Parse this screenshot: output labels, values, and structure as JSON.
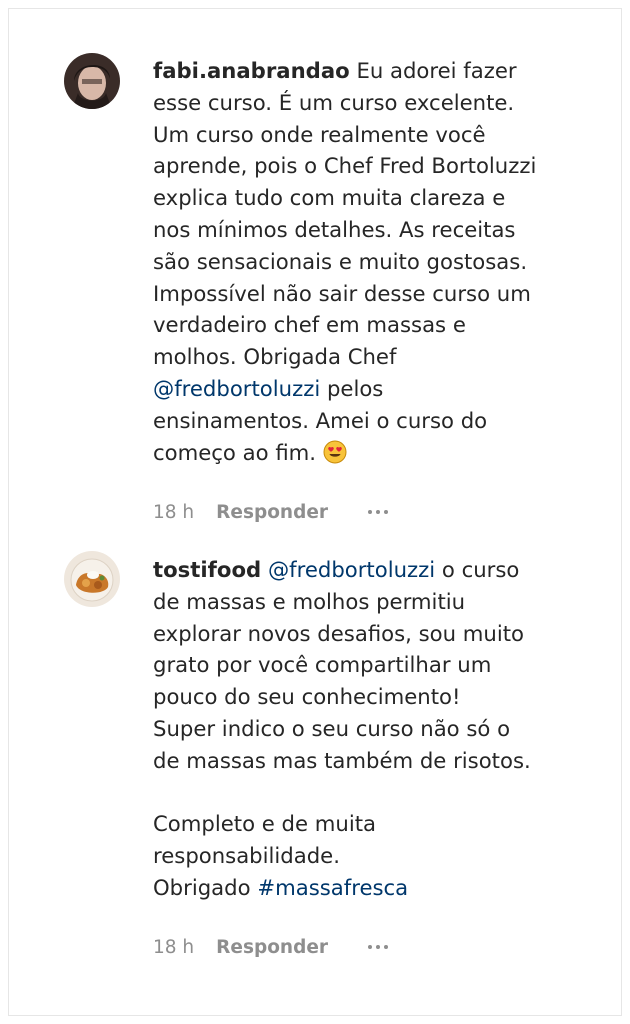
{
  "comments": [
    {
      "username": "fabi.anabrandao",
      "text_before_mention": "Eu adorei fazer\nesse curso. É um curso excelente.\nUm curso onde realmente você\naprende, pois o Chef Fred Bortoluzzi\nexplica tudo com muita clareza e\nnos mínimos detalhes. As receitas\nsão sensacionais e muito gostosas.\nImpossível não sair desse curso um\nverdadeiro chef em massas e\nmolhos. Obrigada Chef\n",
      "mention": "@fredbortoluzzi",
      "text_after_mention": " pelos\nensinamentos. Amei o curso do\ncomeço ao fim. ",
      "emoji_icon": "heart-eyes-emoji-icon",
      "time": "18 h",
      "reply_label": "Responder",
      "avatar_icon": "user-avatar-icon"
    },
    {
      "username": "tostifood",
      "mention": "@fredbortoluzzi",
      "text_after_mention": " o curso\nde massas e molhos permitiu\nexplorar novos desafios, sou muito\ngrato por você compartilhar um\npouco do seu conhecimento!\nSuper indico o seu curso não só o\nde massas mas também de risotos.\n\nCompleto e de muita\nresponsabilidade.\nObrigado ",
      "hashtag": "#massafresca",
      "time": "18 h",
      "reply_label": "Responder",
      "avatar_icon": "food-avatar-icon"
    }
  ],
  "colors": {
    "text": "#262626",
    "link": "#00376b",
    "meta": "#8e8e8e",
    "border": "#e6e6e6"
  }
}
